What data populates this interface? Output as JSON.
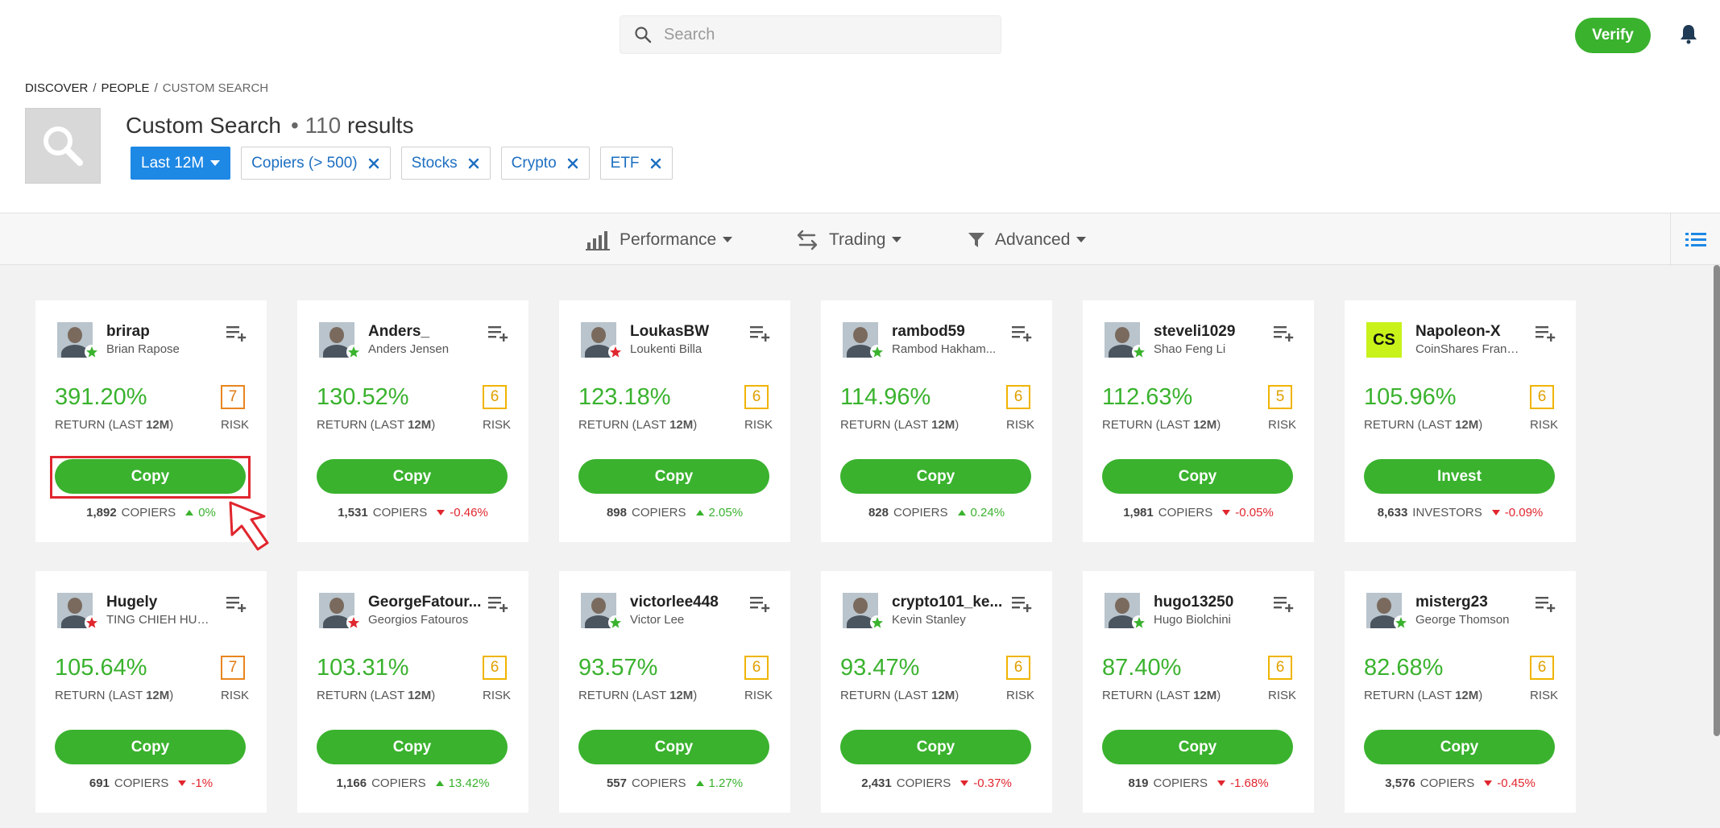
{
  "header": {
    "search_placeholder": "Search",
    "verify_label": "Verify"
  },
  "breadcrumb": [
    "DISCOVER",
    "PEOPLE",
    "CUSTOM SEARCH"
  ],
  "page": {
    "title": "Custom Search",
    "result_prefix": "• 110",
    "result_word": "results"
  },
  "chips": {
    "period": "Last 12M",
    "filters": [
      "Copiers (> 500)",
      "Stocks",
      "Crypto",
      "ETF"
    ]
  },
  "filterbar": {
    "performance": "Performance",
    "trading": "Trading",
    "advanced": "Advanced"
  },
  "card_labels": {
    "return_prefix": "RETURN (LAST ",
    "return_period": "12M",
    "return_suffix": ")",
    "risk": "RISK"
  },
  "traders": [
    {
      "username": "brirap",
      "name": "Brian Rapose",
      "gain": "391.20%",
      "risk": "7",
      "action": "Copy",
      "count": "1,892",
      "count_label": "COPIERS",
      "change": "0%",
      "dir": "up",
      "star": "green"
    },
    {
      "username": "Anders_",
      "name": "Anders Jensen",
      "gain": "130.52%",
      "risk": "6",
      "action": "Copy",
      "count": "1,531",
      "count_label": "COPIERS",
      "change": "-0.46%",
      "dir": "down",
      "star": "green"
    },
    {
      "username": "LoukasBW",
      "name": "Loukenti Billa",
      "gain": "123.18%",
      "risk": "6",
      "action": "Copy",
      "count": "898",
      "count_label": "COPIERS",
      "change": "2.05%",
      "dir": "up",
      "star": "red"
    },
    {
      "username": "rambod59",
      "name": "Rambod Hakham...",
      "gain": "114.96%",
      "risk": "6",
      "action": "Copy",
      "count": "828",
      "count_label": "COPIERS",
      "change": "0.24%",
      "dir": "up",
      "star": "green"
    },
    {
      "username": "steveli1029",
      "name": "Shao Feng Li",
      "gain": "112.63%",
      "risk": "5",
      "action": "Copy",
      "count": "1,981",
      "count_label": "COPIERS",
      "change": "-0.05%",
      "dir": "down",
      "star": "green"
    },
    {
      "username": "Napoleon-X",
      "name": "CoinShares Franc...",
      "gain": "105.96%",
      "risk": "6",
      "action": "Invest",
      "count": "8,633",
      "count_label": "INVESTORS",
      "change": "-0.09%",
      "dir": "down",
      "star": "none",
      "initials": "CS"
    },
    {
      "username": "Hugely",
      "name": "TING CHIEH HUA...",
      "gain": "105.64%",
      "risk": "7",
      "action": "Copy",
      "count": "691",
      "count_label": "COPIERS",
      "change": "-1%",
      "dir": "down",
      "star": "red"
    },
    {
      "username": "GeorgeFatour...",
      "name": "Georgios Fatouros",
      "gain": "103.31%",
      "risk": "6",
      "action": "Copy",
      "count": "1,166",
      "count_label": "COPIERS",
      "change": "13.42%",
      "dir": "up",
      "star": "red"
    },
    {
      "username": "victorlee448",
      "name": "Victor Lee",
      "gain": "93.57%",
      "risk": "6",
      "action": "Copy",
      "count": "557",
      "count_label": "COPIERS",
      "change": "1.27%",
      "dir": "up",
      "star": "green"
    },
    {
      "username": "crypto101_ke...",
      "name": "Kevin Stanley",
      "gain": "93.47%",
      "risk": "6",
      "action": "Copy",
      "count": "2,431",
      "count_label": "COPIERS",
      "change": "-0.37%",
      "dir": "down",
      "star": "green"
    },
    {
      "username": "hugo13250",
      "name": "Hugo Biolchini",
      "gain": "87.40%",
      "risk": "6",
      "action": "Copy",
      "count": "819",
      "count_label": "COPIERS",
      "change": "-1.68%",
      "dir": "down",
      "star": "green"
    },
    {
      "username": "misterg23",
      "name": "George Thomson",
      "gain": "82.68%",
      "risk": "6",
      "action": "Copy",
      "count": "3,576",
      "count_label": "COPIERS",
      "change": "-0.45%",
      "dir": "down",
      "star": "green"
    }
  ],
  "colors": {
    "accent_green": "#3ab22e",
    "chip_blue": "#1e88e5",
    "negative_red": "#e0262e",
    "risk_yellow": "#f0b400",
    "risk_orange": "#e8851e"
  }
}
